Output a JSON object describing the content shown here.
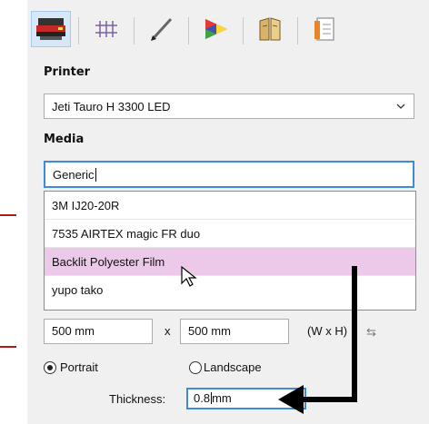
{
  "toolbar": {
    "buttons": [
      {
        "icon": "printer-icon",
        "active": true
      },
      {
        "icon": "grid-icon",
        "active": false
      },
      {
        "icon": "pen-icon",
        "active": false
      },
      {
        "icon": "color-prism-icon",
        "active": false
      },
      {
        "icon": "book-icon",
        "active": false
      },
      {
        "icon": "document-layout-icon",
        "active": false
      }
    ]
  },
  "printer": {
    "label": "Printer",
    "selected": "Jeti Tauro H 3300 LED"
  },
  "media": {
    "label": "Media",
    "input_value": "Generic",
    "options": [
      "3M IJ20-20R",
      "7535 AIRTEX magic FR duo",
      "Backlit Polyester Film",
      "yupo tako"
    ],
    "highlighted": "Backlit Polyester Film"
  },
  "size": {
    "width": "500 mm",
    "separator": "x",
    "height": "500 mm",
    "unit_hint": "(W x H)"
  },
  "orientation": {
    "portrait_label": "Portrait",
    "landscape_label": "Landscape",
    "selected": "Portrait"
  },
  "thickness": {
    "label": "Thickness:",
    "value_before_caret": "0.8",
    "value_after_caret": "mm"
  },
  "colors": {
    "highlight": "#ecc9e8",
    "focus_border": "#3c8ad8",
    "annotation_arrow": "#000000",
    "edge_marker": "#b01818"
  }
}
